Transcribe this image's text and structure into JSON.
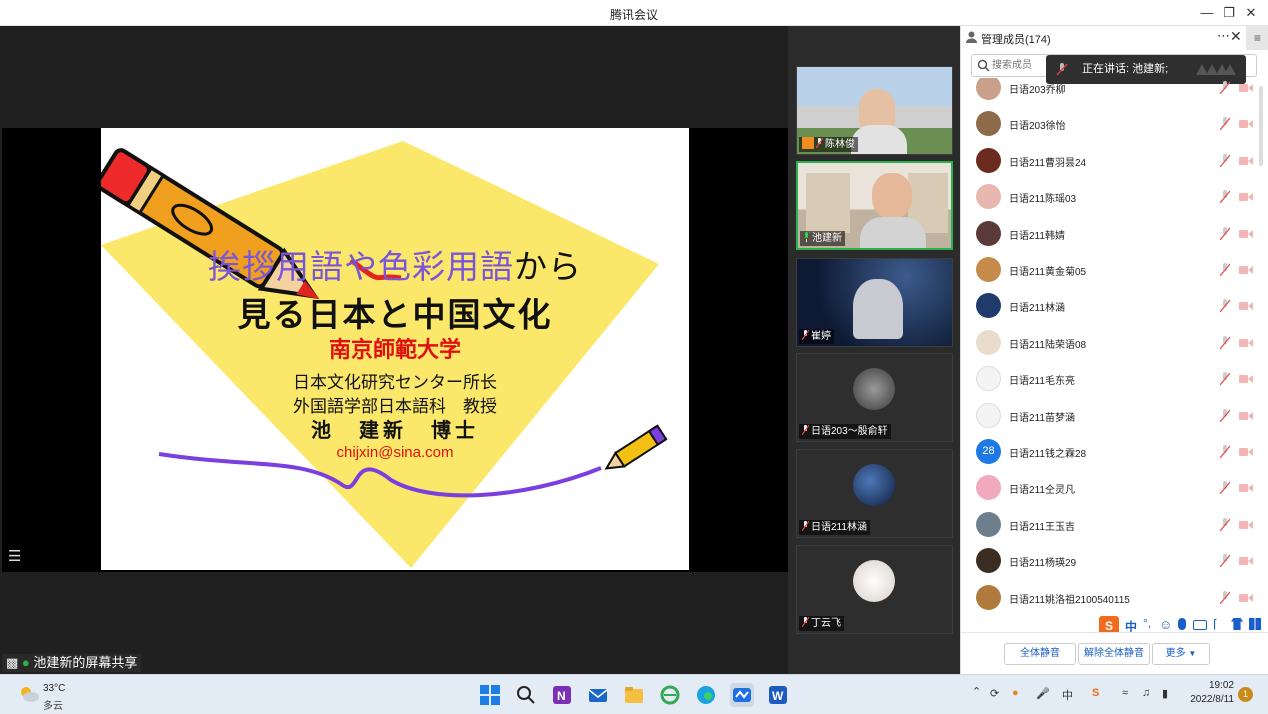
{
  "window": {
    "title": "腾讯会议"
  },
  "slide": {
    "title_purple": "挨拶用語や色彩用語",
    "title_suffix": "から",
    "title_line2": "見る日本と中国文化",
    "university": "南京師範大学",
    "position1": "日本文化研究センター所长",
    "position2": "外国語学部日本語科　教授",
    "name": "池　建新　博士",
    "email": "chijxin@sina.com"
  },
  "stage": {
    "share_label": "池建新的屏幕共享",
    "list_icon": "list-icon"
  },
  "video_tiles": [
    {
      "name": "陈林俊",
      "mic": "muted"
    },
    {
      "name": "池建新",
      "mic": "speaking"
    },
    {
      "name": "崔婷",
      "mic": "muted"
    },
    {
      "name": "日语203～殷俞轩",
      "mic": "muted"
    },
    {
      "name": "日语211林涵",
      "mic": "muted"
    },
    {
      "name": "丁云飞",
      "mic": "muted"
    }
  ],
  "panel": {
    "title": "管理成员(174)",
    "more_icon": "ellipsis-icon",
    "close_icon": "close-icon",
    "search_placeholder": "搜索成员",
    "speaking_text": "正在讲话: 池建新;",
    "members": [
      {
        "name": "日语203乔柳",
        "avatar_color": "#c9a089"
      },
      {
        "name": "日语203徐怡",
        "avatar_color": "#8d6b4a"
      },
      {
        "name": "日语211曹羽昙24",
        "avatar_color": "#6b2b1e"
      },
      {
        "name": "日语211陈瑶03",
        "avatar_color": "#e8b8b0"
      },
      {
        "name": "日语211韩婧",
        "avatar_color": "#5a3a3a"
      },
      {
        "name": "日语211黄金菊05",
        "avatar_color": "#c68a4a"
      },
      {
        "name": "日语211林涵",
        "avatar_color": "#1f3b6b"
      },
      {
        "name": "日语211陆荣语08",
        "avatar_color": "#e9dccb"
      },
      {
        "name": "日语211毛东亮",
        "avatar_color": "#f4f4f4"
      },
      {
        "name": "日语211苗梦涵",
        "avatar_color": "#f4f4f4"
      },
      {
        "name": "日语211钱之霖28",
        "avatar_color": "#1e78e6",
        "avatar_text": "28"
      },
      {
        "name": "日语211仝灵凡",
        "avatar_color": "#f1a9bf"
      },
      {
        "name": "日语211王玉吉",
        "avatar_color": "#6d7f8d"
      },
      {
        "name": "日语211杨瑛29",
        "avatar_color": "#3b2d22"
      },
      {
        "name": "日语211姚洛祖2100540115",
        "avatar_color": "#b07a3c"
      }
    ],
    "buttons": {
      "mute_all": "全体静音",
      "unmute_all": "解除全体静音",
      "more": "更多"
    }
  },
  "taskbar": {
    "temperature": "33°C",
    "condition": "多云",
    "ime_zh": "中",
    "time": "19:02",
    "date": "2022/8/11",
    "notifications": "1"
  }
}
